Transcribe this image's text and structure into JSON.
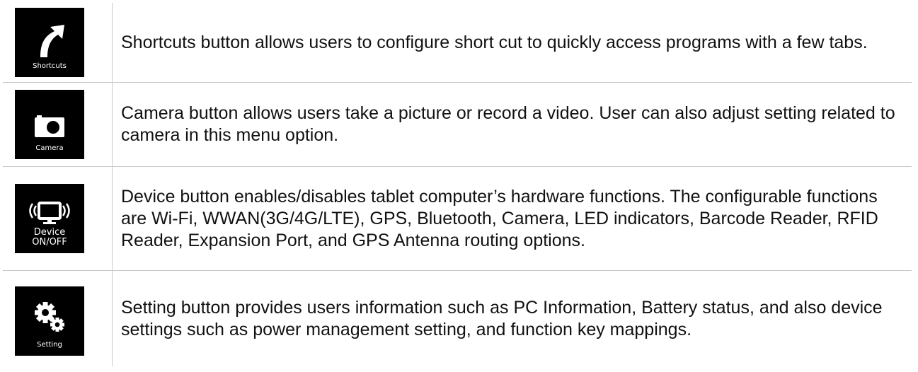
{
  "rows": [
    {
      "icon": "shortcut-arrow-icon",
      "tile_label": "Shortcuts",
      "description": "Shortcuts button allows users to configure short cut to quickly access programs with a few tabs."
    },
    {
      "icon": "camera-icon",
      "tile_label": "Camera",
      "description": "Camera button allows users take a picture or record a video. User can also adjust setting related to camera in this menu option."
    },
    {
      "icon": "monitor-wireless-icon",
      "tile_label_line1": "Device",
      "tile_label_line2": "ON/OFF",
      "description": "Device button enables/disables tablet computer’s hardware functions. The configurable functions are Wi-Fi, WWAN(3G/4G/LTE), GPS, Bluetooth, Camera, LED indicators, Barcode Reader, RFID Reader, Expansion Port, and GPS Antenna routing options."
    },
    {
      "icon": "gears-icon",
      "tile_label": "Setting",
      "description": "Setting button provides users information such as PC Information, Battery status, and also device settings such as power management setting, and function key mappings."
    }
  ],
  "colors": {
    "tile_background": "#000000",
    "tile_foreground": "#ffffff",
    "border": "#c8c8c8",
    "text": "#111111"
  }
}
